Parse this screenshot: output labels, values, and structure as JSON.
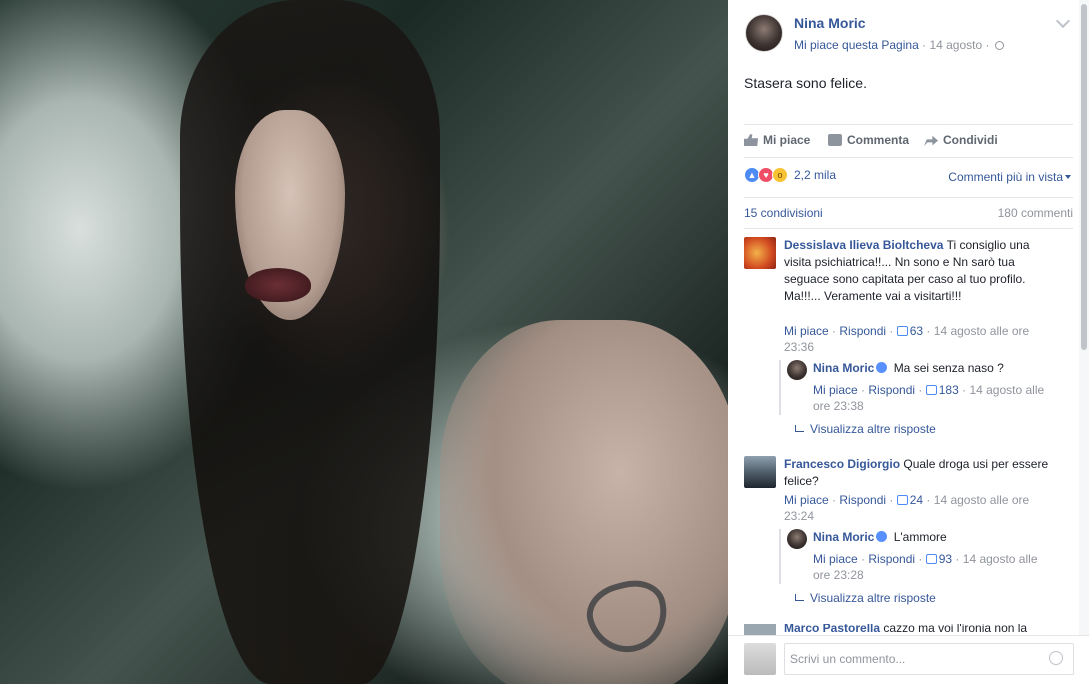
{
  "post": {
    "author": "Nina Moric",
    "like_page": "Mi piace questa Pagina",
    "date": "14 agosto",
    "separator": "·",
    "text": "Stasera sono felice."
  },
  "actions": {
    "like": "Mi piace",
    "comment": "Commenta",
    "share": "Condividi"
  },
  "reactions": {
    "count": "2,2 mila",
    "sort_label": "Commenti più in vista"
  },
  "stats": {
    "shares": "15 condivisioni",
    "comments": "180 commenti"
  },
  "comments": [
    {
      "author": "Dessislava Ilieva Bioltcheva",
      "text": "Ti consiglio una visita psichiatrica!!... Nn sono e Nn sarò tua seguace sono capitata per caso al tuo profilo. Ma!!!... Veramente vai a visitarti!!!",
      "like": "Mi piace",
      "reply": "Rispondi",
      "likes": "63",
      "time": "14 agosto alle ore 23:36",
      "replies": [
        {
          "author": "Nina Moric",
          "text": "Ma sei senza naso ?",
          "like": "Mi piace",
          "reply": "Rispondi",
          "likes": "183",
          "time": "14 agosto alle ore 23:38"
        }
      ],
      "more": "Visualizza altre risposte"
    },
    {
      "author": "Francesco Digiorgio",
      "text": "Quale droga usi per essere felice?",
      "like": "Mi piace",
      "reply": "Rispondi",
      "likes": "24",
      "time": "14 agosto alle ore 23:24",
      "replies": [
        {
          "author": "Nina Moric",
          "text": "L'ammore",
          "like": "Mi piace",
          "reply": "Rispondi",
          "likes": "93",
          "time": "14 agosto alle ore 23:28"
        }
      ],
      "more": "Visualizza altre risposte"
    },
    {
      "author": "Marco Pastorella",
      "text": "cazzo ma voi l'ironia non la"
    }
  ],
  "composer": {
    "placeholder": "Scrivi un commento..."
  },
  "colors": {
    "link": "#365899",
    "meta": "#90949c",
    "like_blue": "#4d8bf5",
    "love_red": "#f04d66",
    "wow_yellow": "#f7c233"
  }
}
